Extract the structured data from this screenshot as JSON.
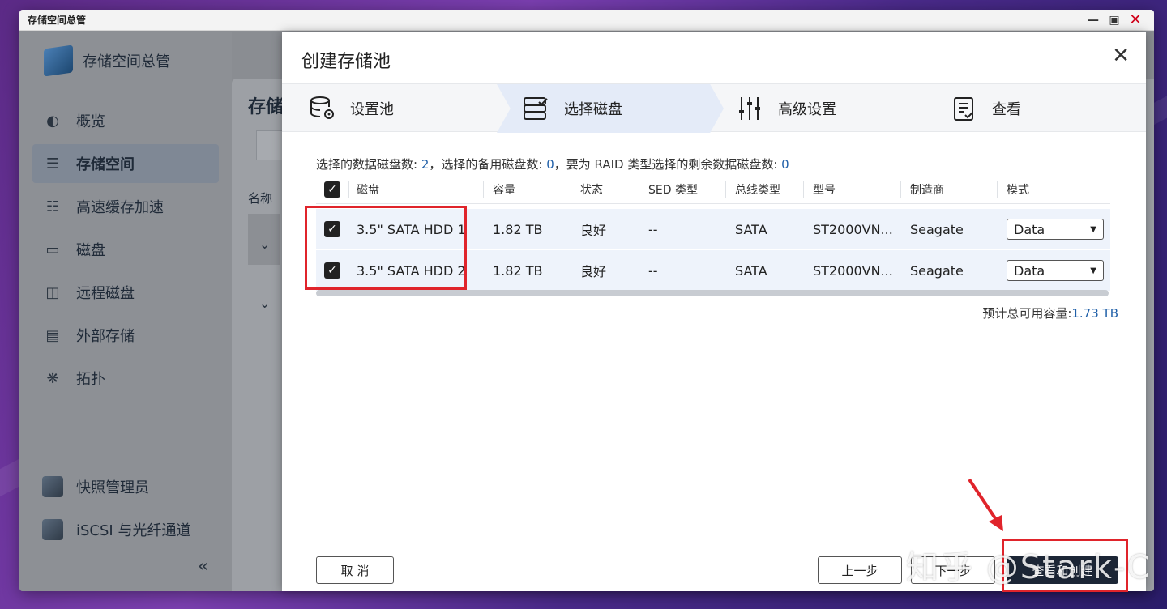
{
  "window": {
    "title": "存储空间总管",
    "controls": [
      "minimize-icon",
      "maximize-icon",
      "close-icon"
    ]
  },
  "sidebar": {
    "brand": "存储空间总管",
    "items": [
      {
        "label": "概览",
        "icon": "gauge-icon"
      },
      {
        "label": "存储空间",
        "icon": "database-icon",
        "active": true
      },
      {
        "label": "高速缓存加速",
        "icon": "cache-icon"
      },
      {
        "label": "磁盘",
        "icon": "disk-icon"
      },
      {
        "label": "远程磁盘",
        "icon": "remote-disk-icon"
      },
      {
        "label": "外部存储",
        "icon": "external-storage-icon"
      },
      {
        "label": "拓扑",
        "icon": "topology-icon"
      }
    ],
    "bottom_items": [
      {
        "label": "快照管理员",
        "icon": "snapshot-icon"
      },
      {
        "label": "iSCSI 与光纤通道",
        "icon": "iscsi-icon"
      }
    ],
    "collapse": "«"
  },
  "main": {
    "title": "存储",
    "column_head": "名称"
  },
  "modal": {
    "title": "创建存储池",
    "steps": [
      {
        "label": "设置池",
        "icon": "pool-settings-icon"
      },
      {
        "label": "选择磁盘",
        "icon": "select-disk-icon",
        "active": true
      },
      {
        "label": "高级设置",
        "icon": "sliders-icon"
      },
      {
        "label": "查看",
        "icon": "checklist-icon"
      }
    ],
    "summary": {
      "prefix1": "选择的数据磁盘数: ",
      "data_count": "2",
      "prefix2": "，选择的备用磁盘数: ",
      "spare_count": "0",
      "prefix3": "，要为 RAID 类型选择的剩余数据磁盘数: ",
      "remaining_count": "0"
    },
    "table": {
      "headers": [
        "磁盘",
        "容量",
        "状态",
        "SED 类型",
        "总线类型",
        "型号",
        "制造商",
        "模式"
      ],
      "rows": [
        {
          "disk": "3.5\" SATA HDD 1",
          "capacity": "1.82 TB",
          "status": "良好",
          "sed": "--",
          "bus": "SATA",
          "model": "ST2000VN...",
          "vendor": "Seagate",
          "mode": "Data"
        },
        {
          "disk": "3.5\" SATA HDD 2",
          "capacity": "1.82 TB",
          "status": "良好",
          "sed": "--",
          "bus": "SATA",
          "model": "ST2000VN...",
          "vendor": "Seagate",
          "mode": "Data"
        }
      ]
    },
    "capacity": {
      "label": "预计总可用容量:",
      "value": "1.73 TB"
    },
    "buttons": {
      "cancel": "取 消",
      "back": "上一步",
      "next": "下一步",
      "create": "查看和创建"
    }
  },
  "watermark": "知乎 @Stark-C",
  "colors": {
    "accent": "#1f5fa8",
    "highlight": "#e0242b",
    "primary_button": "#1c2636"
  }
}
